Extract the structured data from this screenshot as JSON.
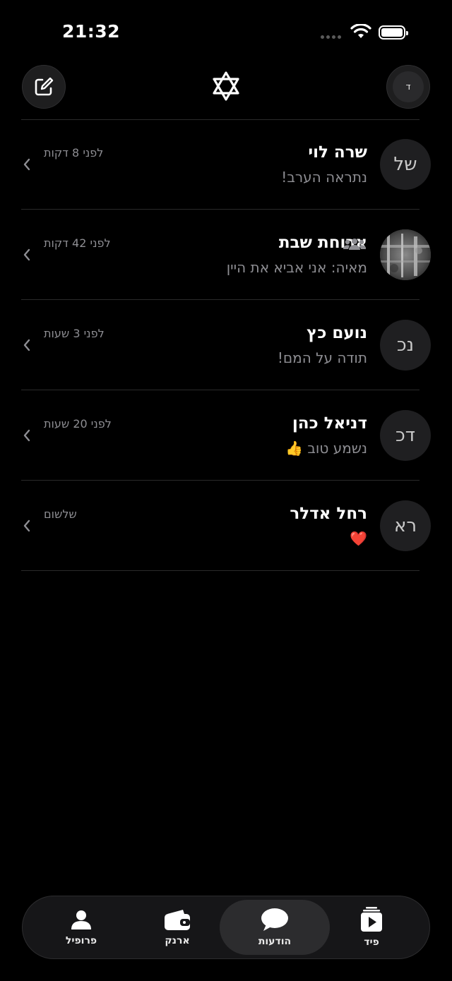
{
  "status": {
    "time": "21:32"
  },
  "chats": [
    {
      "initials": "של",
      "name": "שרה לוי",
      "message": "נתראה הערב!",
      "time": "לפני 8 דקות"
    },
    {
      "initials": "",
      "name": "ארוחת שבת",
      "message": "מאיה: אני אביא את היין",
      "time": "לפני 42 דקות"
    },
    {
      "initials": "נכ",
      "name": "נועם כץ",
      "message": "תודה על המם!",
      "time": "לפני 3 שעות"
    },
    {
      "initials": "דכ",
      "name": "דניאל כהן",
      "message": "נשמע טוב 👍",
      "time": "לפני 20 שעות"
    },
    {
      "initials": "רא",
      "name": "רחל אדלר",
      "message": "❤️",
      "time": "שלשום"
    }
  ],
  "header": {
    "avatar_initial": "ד"
  },
  "tabs": [
    {
      "label": "פרופיל"
    },
    {
      "label": "ארנק"
    },
    {
      "label": "הודעות"
    },
    {
      "label": "פיד"
    }
  ]
}
